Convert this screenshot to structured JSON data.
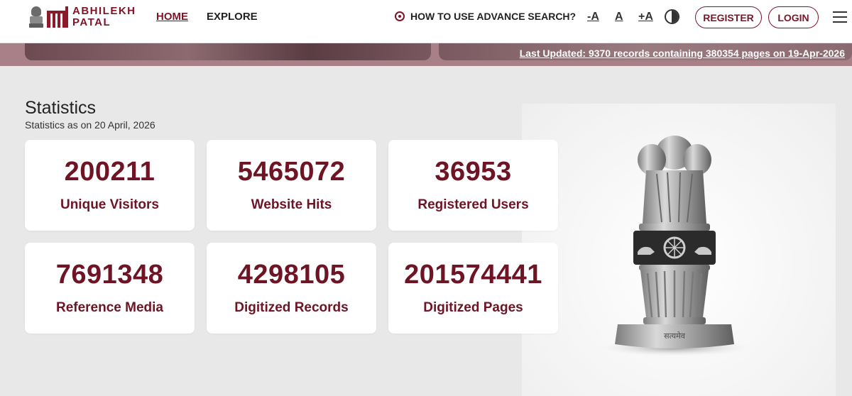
{
  "header": {
    "logo_line1": "ABHILEKH",
    "logo_line2": "PATAL",
    "nav": {
      "home": "HOME",
      "explore": "EXPLORE"
    },
    "help_link": "HOW TO USE ADVANCE SEARCH?",
    "font_size": {
      "decrease": "-A",
      "normal": "A",
      "increase": "+A"
    },
    "register_label": "REGISTER",
    "login_label": "LOGIN"
  },
  "banner": {
    "last_updated": "Last Updated: 9370 records containing 380354 pages on 19-Apr-2026"
  },
  "statistics": {
    "title": "Statistics",
    "subtitle_prefix": "Statistics as on ",
    "subtitle_day": "20",
    "subtitle_month": " April, ",
    "subtitle_year": "2026",
    "cards": [
      {
        "value": "200211",
        "label": "Unique Visitors"
      },
      {
        "value": "5465072",
        "label": "Website Hits"
      },
      {
        "value": "36953",
        "label": "Registered Users"
      },
      {
        "value": "7691348",
        "label": "Reference Media"
      },
      {
        "value": "4298105",
        "label": "Digitized Records"
      },
      {
        "value": "201574441",
        "label": "Digitized Pages"
      }
    ]
  },
  "emblem": {
    "base_text": "सत्यमेव"
  },
  "colors": {
    "brand": "#7a1628",
    "card_text": "#6e1424",
    "background": "#e8e8e8",
    "banner": "#a98088"
  }
}
